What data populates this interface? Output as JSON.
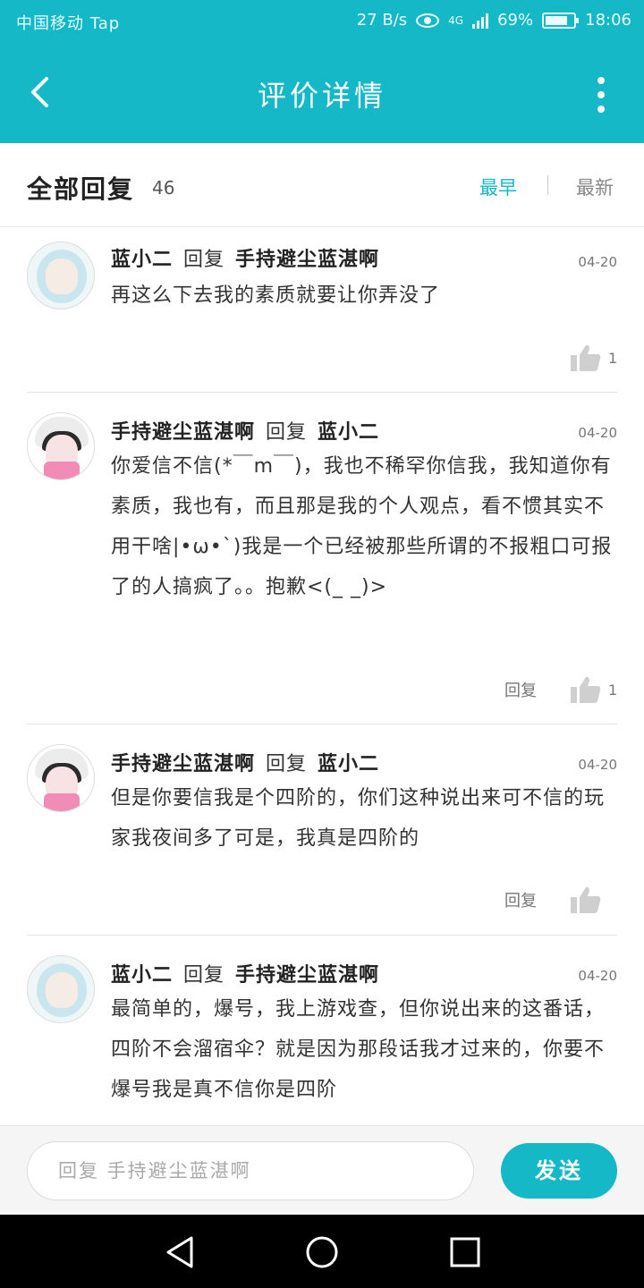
{
  "status_bar": {
    "carrier": "中国移动 Tap",
    "speed": "27 B/s",
    "network": "4G",
    "battery": "69%",
    "time": "18:06"
  },
  "header": {
    "title": "评价详情",
    "back_icon": "back-arrow-icon",
    "more_icon": "more-vertical-icon"
  },
  "replies": {
    "label": "全部回复",
    "count": "46",
    "sort_earliest": "最早",
    "sort_newest": "最新"
  },
  "items": [
    {
      "avatar": "blue-girl",
      "author": "蓝小二",
      "reply_word": "回复",
      "target": "手持避尘蓝湛啊",
      "date": "04-20",
      "text": "再这么下去我的素质就要让你弄没了",
      "reply_label": "",
      "likes": "1"
    },
    {
      "avatar": "panda-girl",
      "author": "手持避尘蓝湛啊",
      "reply_word": "回复",
      "target": "蓝小二",
      "date": "04-20",
      "text": "你爱信不信(*￣m￣)，我也不稀罕你信我，我知道你有素质，我也有，而且那是我的个人观点，看不惯其实不用干啥|•ω•`)我是一个已经被那些所谓的不报粗口可报了的人搞疯了。。抱歉<(_ _)>",
      "reply_label": "回复",
      "likes": "1"
    },
    {
      "avatar": "panda-girl",
      "author": "手持避尘蓝湛啊",
      "reply_word": "回复",
      "target": "蓝小二",
      "date": "04-20",
      "text": "但是你要信我是个四阶的，你们这种说出来可不信的玩家我夜间多了可是，我真是四阶的",
      "reply_label": "回复",
      "likes": ""
    },
    {
      "avatar": "blue-girl",
      "author": "蓝小二",
      "reply_word": "回复",
      "target": "手持避尘蓝湛啊",
      "date": "04-20",
      "text": "最简单的，爆号，我上游戏查，但你说出来的这番话，四阶不会溜宿伞？就是因为那段话我才过来的，你要不爆号我是真不信你是四阶",
      "reply_label": "",
      "likes": ""
    }
  ],
  "input_bar": {
    "placeholder": "回复 手持避尘蓝湛啊",
    "send_label": "发送"
  },
  "colors": {
    "accent": "#14b8c6",
    "thumb": "#cfcfcf"
  }
}
